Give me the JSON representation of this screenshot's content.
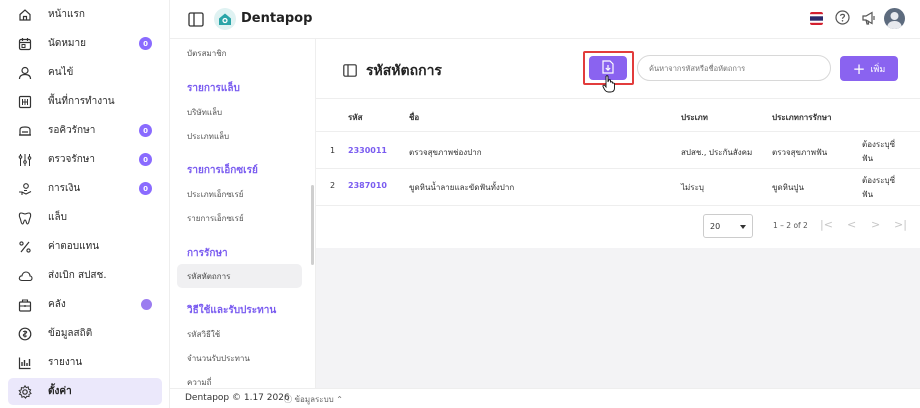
{
  "app": {
    "name": "Dentapop"
  },
  "sidebar": {
    "items": [
      {
        "label": "หน้าแรก",
        "icon": "home-icon"
      },
      {
        "label": "นัดหมาย",
        "icon": "calendar-icon",
        "badge": "0"
      },
      {
        "label": "คนไข้",
        "icon": "user-icon"
      },
      {
        "label": "พื้นที่การทำงาน",
        "icon": "workspace-icon"
      },
      {
        "label": "รอคิวรักษา",
        "icon": "queue-icon",
        "badge": "0"
      },
      {
        "label": "ตรวจรักษา",
        "icon": "treatment-icon",
        "badge": "0"
      },
      {
        "label": "การเงิน",
        "icon": "finance-icon",
        "badge": "0"
      },
      {
        "label": "แล็บ",
        "icon": "tooth-icon"
      },
      {
        "label": "ค่าตอบแทน",
        "icon": "percent-icon"
      },
      {
        "label": "ส่งเบิก สปสช.",
        "icon": "cloud-icon"
      },
      {
        "label": "คลัง",
        "icon": "inventory-icon"
      },
      {
        "label": "ข้อมูลสถิติ",
        "icon": "statistics-icon"
      },
      {
        "label": "รายงาน",
        "icon": "report-icon"
      },
      {
        "label": "ตั้งค่า",
        "icon": "gear-icon"
      }
    ]
  },
  "submenu": {
    "member_card": "บัตรสมาชิก",
    "lab_section": "รายการแล็บ",
    "lab_company": "บริษัทแล็บ",
    "lab_type": "ประเภทแล็บ",
    "xray_section": "รายการเอ็กซเรย์",
    "xray_type": "ประเภทเอ็กซเรย์",
    "xray_list": "รายการเอ็กซเรย์",
    "treatment_section": "การรักษา",
    "treatment_code": "รหัสหัตถการ",
    "usage_section": "วิธีใช้และรับประทาน",
    "usage_code": "รหัสวิธีใช้",
    "intake_amount": "จำนวนรับประทาน",
    "frequency": "ความถี่"
  },
  "header": {
    "flag": "thai-flag-icon",
    "help": "help-icon",
    "announce": "megaphone-icon",
    "avatar": "avatar"
  },
  "page": {
    "title": "รหัสหัตถการ",
    "search_placeholder": "ค้นหาจากรหัสหรือชื่อหัตถการ",
    "add_label": "เพิ่ม"
  },
  "table": {
    "headers": {
      "code": "รหัส",
      "name": "ชื่อ",
      "type": "ประเภท",
      "treatment_type": "ประเภทการรักษา"
    },
    "rows": [
      {
        "index": "1",
        "code": "2330011",
        "name": "ตรวจสุขภาพช่องปาก",
        "type": "สปสช., ประกันสังคม",
        "treatment_type": "ตรวจสุขภาพฟัน",
        "note_line1": "ต้องระบุซี่",
        "note_line2": "ฟัน"
      },
      {
        "index": "2",
        "code": "2387010",
        "name": "ขูดหินน้ำลายและขัดฟันทั้งปาก",
        "type": "ไม่ระบุ",
        "treatment_type": "ขูดหินปูน",
        "note_line1": "ต้องระบุซี่",
        "note_line2": "ฟัน"
      }
    ]
  },
  "pagination": {
    "page_size": "20",
    "info": "1 – 2 of 2",
    "first": "|<",
    "prev": "<",
    "next": ">",
    "last": ">|"
  },
  "footer": {
    "copyright": "Dentapop © 1.17 2026",
    "system_info": "ⓘ ข้อมูลระบบ ⌃"
  },
  "colors": {
    "accent": "#8a63f0",
    "highlight": "#e23c3c"
  }
}
